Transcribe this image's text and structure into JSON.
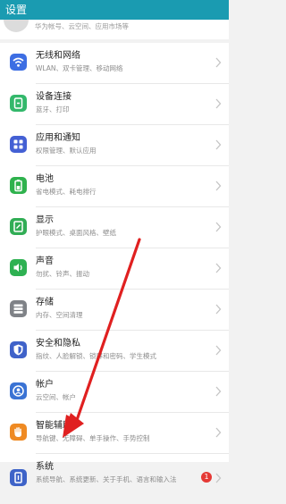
{
  "header": {
    "title": "设置"
  },
  "account": {
    "subtitle": "华为帐号、云空间、应用市场等"
  },
  "items": [
    {
      "title": "无线和网络",
      "subtitle": "WLAN、双卡管理、移动网络",
      "icon": "wifi-icon",
      "color": "#3d6ee3"
    },
    {
      "title": "设备连接",
      "subtitle": "蓝牙、打印",
      "icon": "device-connection-icon",
      "color": "#33b86b"
    },
    {
      "title": "应用和通知",
      "subtitle": "权限管理、默认应用",
      "icon": "apps-icon",
      "color": "#4460d4"
    },
    {
      "title": "电池",
      "subtitle": "省电模式、耗电排行",
      "icon": "battery-icon",
      "color": "#2fb24d"
    },
    {
      "title": "显示",
      "subtitle": "护眼模式、桌面风格、壁纸",
      "icon": "display-icon",
      "color": "#31ad55"
    },
    {
      "title": "声音",
      "subtitle": "勿扰、铃声、振动",
      "icon": "sound-icon",
      "color": "#2eb152"
    },
    {
      "title": "存储",
      "subtitle": "内存、空间清理",
      "icon": "storage-icon",
      "color": "#7f8287"
    },
    {
      "title": "安全和隐私",
      "subtitle": "指纹、人脸解锁、锁屏和密码、学生模式",
      "icon": "shield-icon",
      "color": "#3f62c9"
    },
    {
      "title": "帐户",
      "subtitle": "云空间、帐户",
      "icon": "account-icon",
      "color": "#3a73d4"
    },
    {
      "title": "智能辅助",
      "subtitle": "导航键、无障碍、单手操作、手势控制",
      "icon": "hand-icon",
      "color": "#ef8a22"
    },
    {
      "title": "系统",
      "subtitle": "系统导航、系统更新、关于手机、语言和输入法",
      "icon": "system-icon",
      "color": "#3e63c8",
      "badge": "1"
    }
  ],
  "colors": {
    "header": "#1a9bb1",
    "annotation_arrow": "#e02020",
    "badge": "#e53935"
  }
}
